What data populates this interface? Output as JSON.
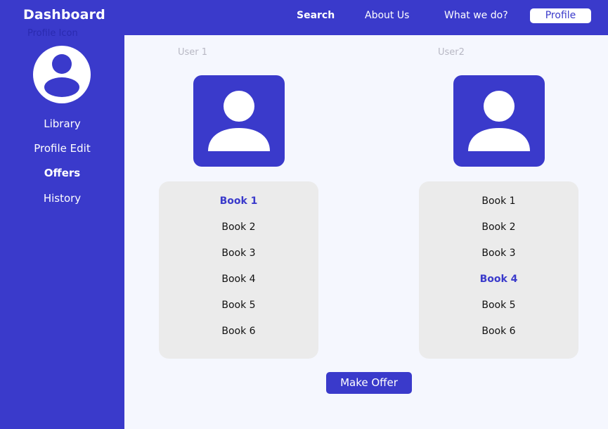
{
  "brand": {
    "title": "Dashboard",
    "profile_icon_caption": "Profile Icon"
  },
  "sidebar": {
    "items": [
      {
        "label": "Library",
        "active": false
      },
      {
        "label": "Profile Edit",
        "active": false
      },
      {
        "label": "Offers",
        "active": true
      },
      {
        "label": "History",
        "active": false
      }
    ]
  },
  "nav": {
    "search": "Search",
    "about": "About Us",
    "what": "What we do?",
    "profile": "Profile"
  },
  "users": [
    {
      "caption": "User 1",
      "books": [
        "Book 1",
        "Book 2",
        "Book 3",
        "Book 4",
        "Book 5",
        "Book 6"
      ],
      "selected_book": "Book 1"
    },
    {
      "caption": "User2",
      "books": [
        "Book 1",
        "Book 2",
        "Book 3",
        "Book 4",
        "Book 5",
        "Book 6"
      ],
      "selected_book": "Book 4"
    }
  ],
  "action": {
    "make_offer": "Make Offer"
  },
  "colors": {
    "accent": "#3a3acb",
    "panel": "#ebebeb",
    "background": "#f5f7fe"
  },
  "icons": {
    "avatar": "user-avatar-icon"
  }
}
